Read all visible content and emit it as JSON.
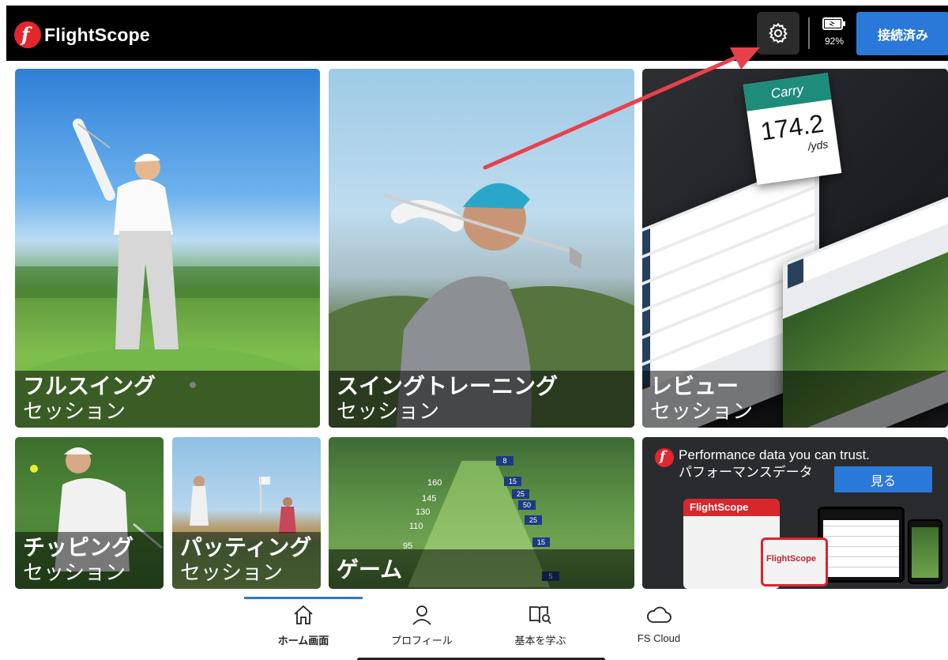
{
  "header": {
    "brand": "FlightScope",
    "battery_percent": "92%",
    "connect_label": "接続済み"
  },
  "tiles": {
    "full_swing": {
      "title": "フルスイング",
      "subtitle": "セッション"
    },
    "swing_training": {
      "title": "スイングトレーニング",
      "subtitle": "セッション"
    },
    "review": {
      "title": "レビュー",
      "subtitle": "セッション"
    },
    "chipping": {
      "title": "チッピング",
      "subtitle": "セッション"
    },
    "putting": {
      "title": "パッティング",
      "subtitle": "セッション"
    },
    "game": {
      "title": "ゲーム"
    }
  },
  "review_art": {
    "carry_title": "Carry",
    "carry_value": "174.2",
    "carry_unit": "/yds"
  },
  "game_art": {
    "yardages": [
      "160",
      "145",
      "130",
      "110",
      "95"
    ],
    "targets": [
      "8",
      "15",
      "25",
      "50",
      "25",
      "15",
      "5"
    ]
  },
  "promo": {
    "line1": "Performance data you can trust.",
    "line2": "パフォーマンスデータ",
    "button_label": "見る",
    "device_brand": "FlightScope"
  },
  "bottom_nav": {
    "items": [
      {
        "label": "ホーム画面",
        "icon": "home-icon"
      },
      {
        "label": "プロフィール",
        "icon": "profile-icon"
      },
      {
        "label": "基本を学ぶ",
        "icon": "learn-book-icon"
      },
      {
        "label": "FS Cloud",
        "icon": "cloud-icon"
      }
    ],
    "active_index": 0
  },
  "colors": {
    "accent_blue": "#2a78d8",
    "brand_red": "#e3262d",
    "annotation_arrow": "#e8414c"
  }
}
